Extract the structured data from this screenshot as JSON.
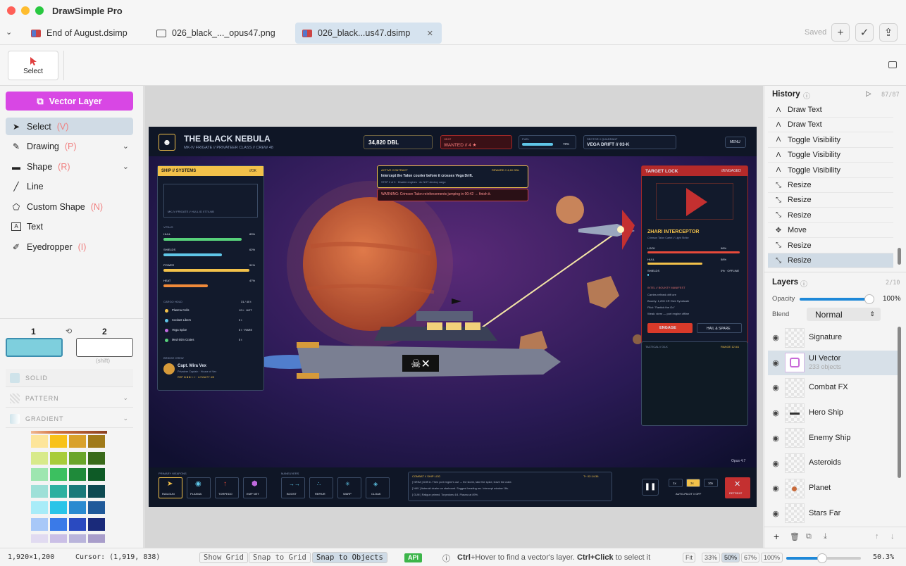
{
  "app": {
    "title": "DrawSimple Pro"
  },
  "tabs": [
    {
      "label": "End of August.dsimp"
    },
    {
      "label": "026_black_..._opus47.png"
    },
    {
      "label": "026_black...us47.dsimp"
    }
  ],
  "header": {
    "saved": "Saved"
  },
  "toolbar": {
    "select_label": "Select"
  },
  "left": {
    "vector_layer_button": "Vector Layer",
    "tools": [
      {
        "label": "Select",
        "shortcut": "(V)"
      },
      {
        "label": "Drawing",
        "shortcut": "(P)"
      },
      {
        "label": "Shape",
        "shortcut": "(R)"
      },
      {
        "label": "Line",
        "shortcut": ""
      },
      {
        "label": "Custom Shape",
        "shortcut": "(N)"
      },
      {
        "label": "Text",
        "shortcut": ""
      },
      {
        "label": "Eyedropper",
        "shortcut": "(I)"
      }
    ],
    "color1_label": "1",
    "color2_label": "2",
    "shift_hint": "(shift)",
    "color1": "#7ecfdd",
    "fill_modes": [
      "SOLID",
      "PATTERN",
      "GRADIENT"
    ]
  },
  "artwork": {
    "title": "THE BLACK NEBULA",
    "subtitle": "MK-IV FRIGATE // PRIVATEER CLASS // CREW 48",
    "credits": "34,820 DBL",
    "heat_label": "HEAT",
    "wanted": "WANTED // 4 ★",
    "fuel_label": "FUEL",
    "fuel_pct": "78%",
    "fuel_level": 0.78,
    "sector_label": "SECTOR // QUADRANT",
    "sector": "VEGA DRIFT // 03-K",
    "menu": "MENU",
    "systems_title": "SHIP // SYSTEMS",
    "systems_status": "//OK",
    "ship_caption": "MK-IV FRIGATE // HULL ID 0774-NB",
    "vitals_label": "VITALS",
    "vitals": [
      {
        "name": "HULL",
        "value": "83%",
        "level": 0.83,
        "color": "#57d07a"
      },
      {
        "name": "SHIELDS",
        "value": "62%",
        "level": 0.62,
        "color": "#5fc6e8"
      },
      {
        "name": "POWER",
        "value": "91%",
        "level": 0.91,
        "color": "#f2c14a"
      },
      {
        "name": "HEAT",
        "value": "47%",
        "level": 0.47,
        "color": "#f08a3a"
      }
    ],
    "cargo_label": "CARGO HOLD",
    "cargo_count": "31 / 40 t",
    "cargo": [
      {
        "name": "Plasma Cells",
        "value": "12 t · HOT",
        "color": "#f2c14a"
      },
      {
        "name": "Coolant Libers",
        "value": "9 t",
        "color": "#5fc6e8"
      },
      {
        "name": "Vega Spice",
        "value": "5 t · RARE",
        "color": "#c06adf"
      },
      {
        "name": "Med-Stim Crates",
        "value": "5 t",
        "color": "#57d07a"
      }
    ],
    "crew_label": "BRIDGE CREW",
    "captain": "Capt. Mira Vex",
    "captain_sub": "Privateer Captain · House of Vex",
    "captain_rep": "REP ★★★☆☆ · LOYALTY 4/5",
    "contract_label": "ACTIVE CONTRACT",
    "contract_reward": "REWARD // 4,4K DBL",
    "contract_text": "Intercept the Talon courier before it crosses Vega Drift.",
    "contract_step": "STEP 2 of 3 · Disable engines · do NOT destroy cargo",
    "warning": "WARNING: Crimson Talon reinforcements jumping in 00:42 → finish it.",
    "target_title": "TARGET LOCK",
    "target_status": "//ENGAGED",
    "target_name": "ZHARI INTERCEPTOR",
    "target_sub": "Crimson Talon Cartel // Light Strike",
    "target_stats": [
      {
        "name": "LOCK",
        "value": "98%",
        "level": 0.98,
        "color": "#e74a3a"
      },
      {
        "name": "HULL",
        "value": "58%",
        "level": 0.58,
        "color": "#f2c14a"
      },
      {
        "name": "SHIELDS",
        "value": "0% · OFFLINE",
        "level": 0.0,
        "color": "#5fc6e8"
      }
    ],
    "intel_label": "INTEL // BOUNTY MANIFEST",
    "intel": [
      "Carries refined drift ore",
      "Bounty: 1,200 CR Hive Syndicate",
      "Pilot: \"Fantick the Ox\"",
      "Weak: stern — port engine offline"
    ],
    "engage": "ENGAGE",
    "hail": "HAIL & SPARE",
    "tactical_label": "TACTICAL // 03-K",
    "tactical_range": "RANGE 12 AU",
    "weapons_label": "PRIMARY WEAPONS",
    "weapons": [
      "RAILGUN",
      "PLASMA",
      "TORPEDO",
      "EMP NET"
    ],
    "maneuvers_label": "MANEUVERS",
    "maneuvers": [
      "BOOST",
      "REPAIR",
      "WARP",
      "CLOAK"
    ],
    "log_label": "COMBAT // SHIP LOG",
    "log_time": "T+ 02:14:36",
    "log": [
      "[ NRSA ] Drift in. Then port engine's out → the storm, take the spice, leave the crate.",
      "[ NAV ] Asteroid cluster on starboard. Suggest heading arc. Intercept window 18s.",
      "[ GUN ] Railgun primed. Torpedoes 4/4. Plasma at 89%."
    ],
    "speeds": [
      "1x",
      "3x",
      "10x"
    ],
    "autopilot": "AUTO-PILOT // OFF",
    "retreat": "RETREAT",
    "signature": "Opus 4.7"
  },
  "history": {
    "title": "History",
    "count": "87/87",
    "items": [
      "Draw Text",
      "Draw Text",
      "Toggle Visibility",
      "Toggle Visibility",
      "Toggle Visibility",
      "Resize",
      "Resize",
      "Resize",
      "Move",
      "Resize",
      "Resize"
    ]
  },
  "layers": {
    "title": "Layers",
    "count": "2/10",
    "opacity_label": "Opacity",
    "opacity_value": "100%",
    "opacity_level": 1.0,
    "blend_label": "Blend",
    "blend_value": "Normal",
    "items": [
      {
        "name": "Signature",
        "sub": ""
      },
      {
        "name": "UI Vector",
        "sub": "233 objects"
      },
      {
        "name": "Combat FX",
        "sub": ""
      },
      {
        "name": "Hero Ship",
        "sub": ""
      },
      {
        "name": "Enemy Ship",
        "sub": ""
      },
      {
        "name": "Asteroids",
        "sub": ""
      },
      {
        "name": "Planet",
        "sub": ""
      },
      {
        "name": "Stars Far",
        "sub": ""
      }
    ]
  },
  "status": {
    "dimensions": "1,920×1,200",
    "cursor": "Cursor: (1,919, 838)",
    "show_grid": "Show Grid",
    "snap_grid": "Snap to Grid",
    "snap_objects": "Snap to Objects",
    "api": "API",
    "hint_a": "Ctrl",
    "hint_b": "+Hover to find a vector's layer. ",
    "hint_c": "Ctrl+Click",
    "hint_d": " to select it",
    "zoom_fit": "Fit",
    "zoom_options": [
      "33%",
      "50%",
      "67%",
      "100%"
    ],
    "zoom_value": "50.3%"
  }
}
